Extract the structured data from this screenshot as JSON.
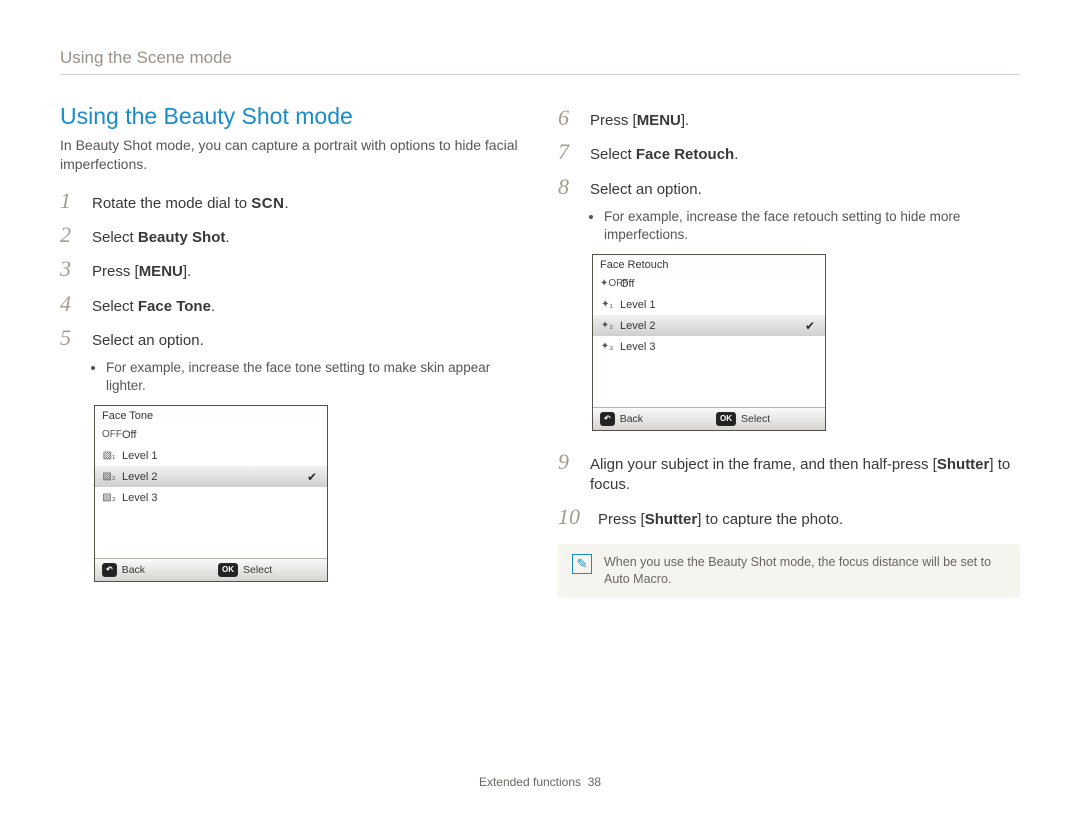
{
  "running_head": "Using the Scene mode",
  "section_title": "Using the Beauty Shot mode",
  "intro": "In Beauty Shot mode, you can capture a portrait with options to hide facial imperfections.",
  "glyphs": {
    "scn": "SCN",
    "menu": "MENU"
  },
  "left_steps": {
    "s1_a": "Rotate the mode dial to ",
    "s1_b": ".",
    "s2_a": "Select ",
    "s2_b": "Beauty Shot",
    "s2_c": ".",
    "s3_a": "Press [",
    "s3_b": "].",
    "s4_a": "Select ",
    "s4_b": "Face Tone",
    "s4_c": ".",
    "s5": "Select an option.",
    "s5_sub": "For example, increase the face tone setting to make skin appear lighter."
  },
  "right_steps": {
    "s6_a": "Press [",
    "s6_b": "].",
    "s7_a": "Select ",
    "s7_b": "Face Retouch",
    "s7_c": ".",
    "s8": "Select an option.",
    "s8_sub": "For example, increase the face retouch setting to hide more imperfections.",
    "s9_a": "Align your subject in the frame, and then half-press [",
    "s9_b": "Shutter",
    "s9_c": "] to focus.",
    "s10_a": "Press [",
    "s10_b": "Shutter",
    "s10_c": "] to capture the photo."
  },
  "shot_face_tone": {
    "title": "Face Tone",
    "rows": [
      {
        "icon": "OFF",
        "label": "Off",
        "sel": false
      },
      {
        "icon": "▧₁",
        "label": "Level 1",
        "sel": false
      },
      {
        "icon": "▧₂",
        "label": "Level 2",
        "sel": true
      },
      {
        "icon": "▧₃",
        "label": "Level 3",
        "sel": false
      }
    ],
    "back_key": "↶",
    "back": "Back",
    "select_key": "OK",
    "select": "Select"
  },
  "shot_face_retouch": {
    "title": "Face Retouch",
    "rows": [
      {
        "icon": "✦OFF",
        "label": "Off",
        "sel": false
      },
      {
        "icon": "✦₁",
        "label": "Level 1",
        "sel": false
      },
      {
        "icon": "✦₂",
        "label": "Level 2",
        "sel": true
      },
      {
        "icon": "✦₃",
        "label": "Level 3",
        "sel": false
      }
    ],
    "back_key": "↶",
    "back": "Back",
    "select_key": "OK",
    "select": "Select"
  },
  "note": "When you use the Beauty Shot mode, the focus distance will be set to Auto Macro.",
  "footer_a": "Extended functions",
  "footer_b": "38"
}
